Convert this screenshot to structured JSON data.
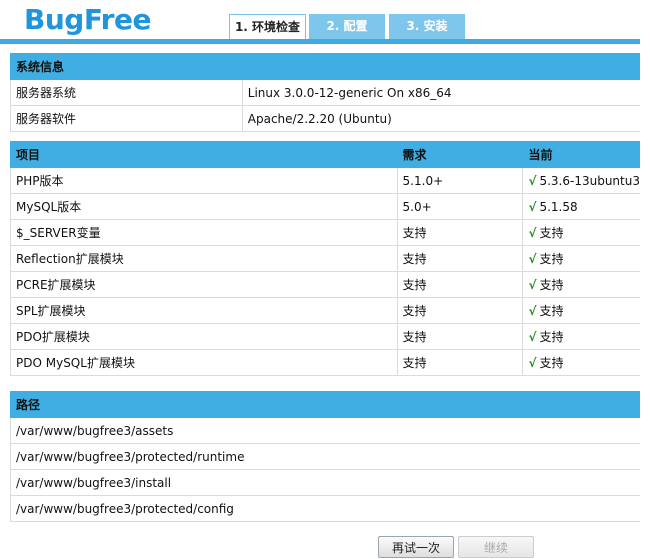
{
  "brand": {
    "logo_text": "BugFree",
    "accent": "#1f95dd",
    "header_bar": "#41aee3"
  },
  "tabs": [
    {
      "label": "1. 环境检查",
      "active": true
    },
    {
      "label": "2. 配置",
      "active": false
    },
    {
      "label": "3. 安装",
      "active": false
    }
  ],
  "system_info": {
    "title": "系统信息",
    "rows": [
      {
        "label": "服务器系统",
        "value": "Linux 3.0.0-12-generic On x86_64"
      },
      {
        "label": "服务器软件",
        "value": "Apache/2.2.20 (Ubuntu)"
      }
    ]
  },
  "requirements": {
    "headers": {
      "item": "项目",
      "required": "需求",
      "current": "当前"
    },
    "check_mark": "√",
    "rows": [
      {
        "item": "PHP版本",
        "required": "5.1.0+",
        "current": "5.3.6-13ubuntu3"
      },
      {
        "item": "MySQL版本",
        "required": "5.0+",
        "current": "5.1.58"
      },
      {
        "item": "$_SERVER变量",
        "required": "支持",
        "current": "支持"
      },
      {
        "item": "Reflection扩展模块",
        "required": "支持",
        "current": "支持"
      },
      {
        "item": "PCRE扩展模块",
        "required": "支持",
        "current": "支持"
      },
      {
        "item": "SPL扩展模块",
        "required": "支持",
        "current": "支持"
      },
      {
        "item": "PDO扩展模块",
        "required": "支持",
        "current": "支持"
      },
      {
        "item": "PDO MySQL扩展模块",
        "required": "支持",
        "current": "支持"
      }
    ]
  },
  "paths": {
    "title": "路径",
    "rows": [
      "/var/www/bugfree3/assets",
      "/var/www/bugfree3/protected/runtime",
      "/var/www/bugfree3/install",
      "/var/www/bugfree3/protected/config"
    ]
  },
  "actions": {
    "retry_label": "再试一次",
    "continue_label": "继续"
  }
}
